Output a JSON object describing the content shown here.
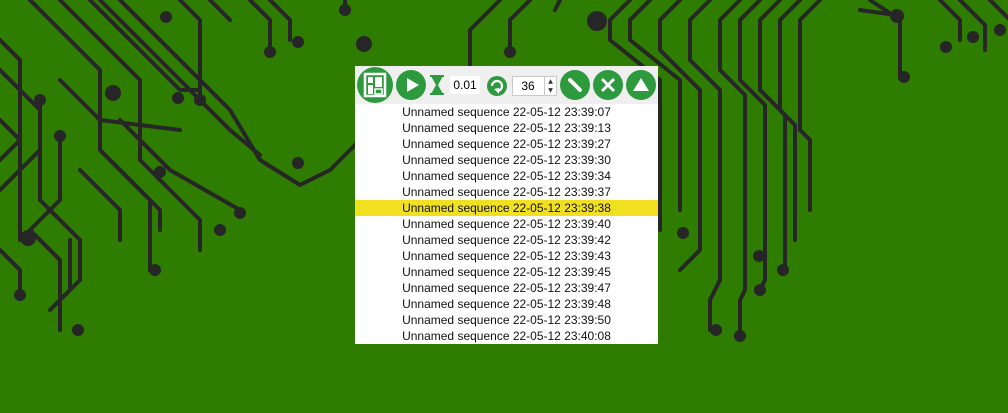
{
  "background": {
    "color": "#2e7d00",
    "trace_color": "#262626"
  },
  "toolbar": {
    "logo_icon": "app-logo-icon",
    "play_icon": "play-icon",
    "interval_icon": "hourglass-icon",
    "interval_value": "0.01",
    "repeat_icon": "repeat-icon",
    "repeat_count": "36",
    "edit_icon": "pencil-icon",
    "delete_icon": "close-icon",
    "up_icon": "triangle-up-icon",
    "accent": "#2e9a3e"
  },
  "sequences": {
    "selected_index": 6,
    "highlight_color": "#f0e020",
    "items": [
      "Unnamed sequence 22-05-12 23:39:07",
      "Unnamed sequence 22-05-12 23:39:13",
      "Unnamed sequence 22-05-12 23:39:27",
      "Unnamed sequence 22-05-12 23:39:30",
      "Unnamed sequence 22-05-12 23:39:34",
      "Unnamed sequence 22-05-12 23:39:37",
      "Unnamed sequence 22-05-12 23:39:38",
      "Unnamed sequence 22-05-12 23:39:40",
      "Unnamed sequence 22-05-12 23:39:42",
      "Unnamed sequence 22-05-12 23:39:43",
      "Unnamed sequence 22-05-12 23:39:45",
      "Unnamed sequence 22-05-12 23:39:47",
      "Unnamed sequence 22-05-12 23:39:48",
      "Unnamed sequence 22-05-12 23:39:50",
      "Unnamed sequence 22-05-12 23:40:08"
    ]
  }
}
